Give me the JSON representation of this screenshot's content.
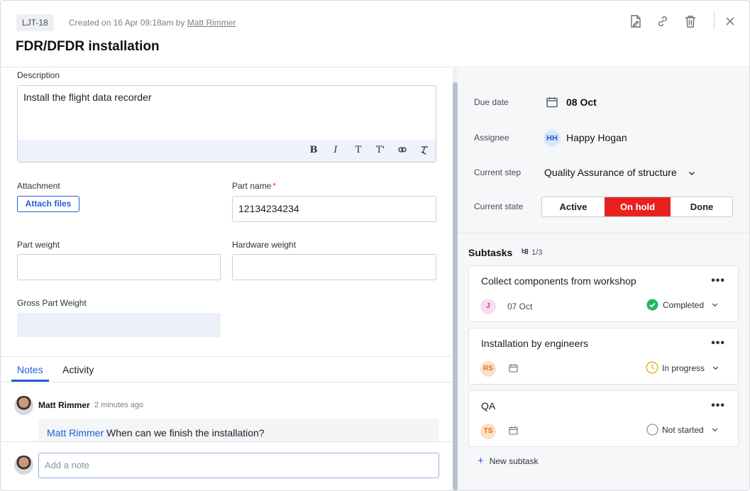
{
  "header": {
    "id_badge": "LJT-18",
    "created_prefix": "Created on 16 Apr 09:18am by ",
    "created_by": "Matt Rimmer",
    "title": "FDR/DFDR installation"
  },
  "description": {
    "label": "Description",
    "value": "Install the flight data recorder",
    "toolbar": [
      "B",
      "I",
      "T",
      "T'",
      "link",
      "clear"
    ]
  },
  "fields": {
    "attachment_label": "Attachment",
    "attach_button": "Attach files",
    "part_name_label": "Part name",
    "part_name_required": "*",
    "part_name_value": "12134234234",
    "part_weight_label": "Part weight",
    "part_weight_value": "",
    "hardware_weight_label": "Hardware weight",
    "hardware_weight_value": "",
    "gross_weight_label": "Gross Part Weight",
    "gross_weight_value": ""
  },
  "tabs": [
    "Notes",
    "Activity"
  ],
  "note": {
    "author": "Matt Rimmer",
    "time": "2 minutes ago",
    "mention": "Matt Rimmer",
    "text": " When can we finish the installation?",
    "composer_placeholder": "Add a note"
  },
  "details": {
    "due_label": "Due date",
    "due_value": "08 Oct",
    "assignee_label": "Assignee",
    "assignee_initials": "HH",
    "assignee_name": "Happy Hogan",
    "step_label": "Current step",
    "step_value": "Quality Assurance of structure",
    "state_label": "Current state",
    "states": [
      "Active",
      "On hold",
      "Done"
    ],
    "active_state": "On hold",
    "state_color": "#e8211f"
  },
  "subtasks": {
    "title": "Subtasks",
    "count": "1/3",
    "items": [
      {
        "title": "Collect components from workshop",
        "initials": "J",
        "date": "07 Oct",
        "status": "Completed",
        "avatar_bg": "#f9dcef",
        "avatar_fg": "#c2379b"
      },
      {
        "title": "Installation by engineers",
        "initials": "RS",
        "date": "",
        "status": "In progress",
        "avatar_bg": "#fde0c8",
        "avatar_fg": "#d9731e"
      },
      {
        "title": "QA",
        "initials": "TS",
        "date": "",
        "status": "Not started",
        "avatar_bg": "#fde0c8",
        "avatar_fg": "#d9731e"
      }
    ],
    "new_label": "New subtask"
  }
}
